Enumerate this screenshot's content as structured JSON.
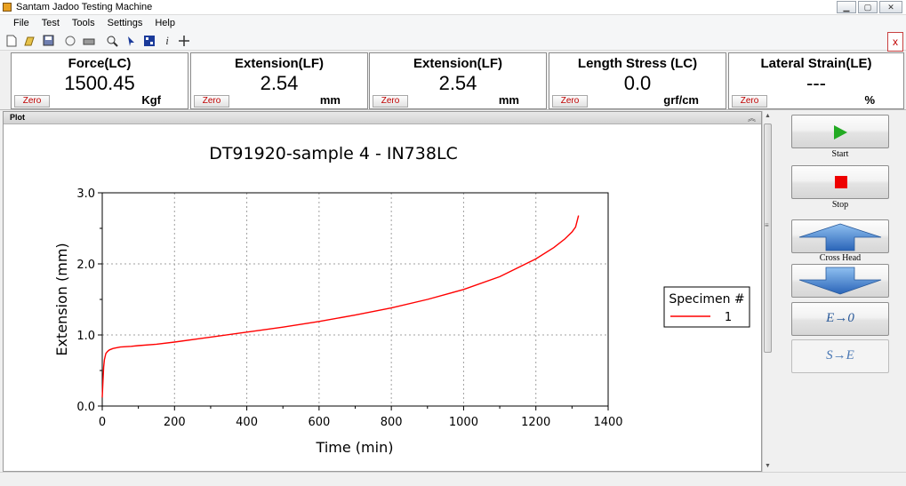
{
  "window": {
    "title": "Santam Jadoo Testing Machine",
    "close_label": "x"
  },
  "menu": [
    "File",
    "Test",
    "Tools",
    "Settings",
    "Help"
  ],
  "toolbar": {
    "icons": [
      "new-icon",
      "open-icon",
      "save-icon",
      "preview-icon",
      "print-icon",
      "zoom-icon",
      "pointer-icon",
      "grid-icon",
      "info-icon",
      "move-icon"
    ]
  },
  "readouts": [
    {
      "title": "Force(LC)",
      "value": "1500.45",
      "unit": "Kgf",
      "zero_label": "Zero"
    },
    {
      "title": "Extension(LF)",
      "value": "2.54",
      "unit": "mm",
      "zero_label": "Zero"
    },
    {
      "title": "Extension(LF)",
      "value": "2.54",
      "unit": "mm",
      "zero_label": "Zero"
    },
    {
      "title": "Length Stress (LC)",
      "value": "0.0",
      "unit": "grf/cm",
      "zero_label": "Zero"
    },
    {
      "title": "Lateral Strain(LE)",
      "value": "---",
      "unit": "%",
      "zero_label": "Zero"
    }
  ],
  "plot_panel": {
    "label": "Plot"
  },
  "controls": {
    "start_label": "Start",
    "stop_label": "Stop",
    "crosshead_label": "Cross Head",
    "e_to_zero": "E→0",
    "s_to_e": "S→E"
  },
  "colors": {
    "series": "#ff0000",
    "start": "#22aa22",
    "stop": "#ee0000",
    "arrow": "#3a7ad0"
  },
  "chart_data": {
    "type": "line",
    "title": "DT91920-sample 4 - IN738LC",
    "xlabel": "Time (min)",
    "ylabel": "Extension (mm)",
    "xlim": [
      0,
      1400
    ],
    "ylim": [
      0,
      3
    ],
    "xticks": [
      0,
      200,
      400,
      600,
      800,
      1000,
      1200,
      1400
    ],
    "yticks": [
      0,
      1,
      2,
      3
    ],
    "grid": true,
    "legend": {
      "title": "Specimen #",
      "position": "right"
    },
    "series": [
      {
        "name": "1",
        "x": [
          0,
          2,
          4,
          6,
          8,
          10,
          15,
          20,
          30,
          50,
          80,
          100,
          150,
          200,
          300,
          400,
          500,
          600,
          700,
          800,
          900,
          1000,
          1100,
          1200,
          1250,
          1280,
          1300,
          1310,
          1318
        ],
        "y": [
          0.12,
          0.35,
          0.55,
          0.65,
          0.7,
          0.74,
          0.77,
          0.79,
          0.81,
          0.83,
          0.84,
          0.85,
          0.87,
          0.9,
          0.97,
          1.04,
          1.11,
          1.19,
          1.28,
          1.38,
          1.5,
          1.64,
          1.82,
          2.07,
          2.23,
          2.35,
          2.45,
          2.52,
          2.68
        ]
      }
    ]
  }
}
